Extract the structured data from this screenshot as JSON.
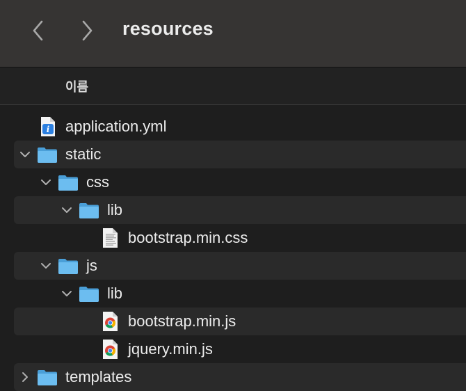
{
  "window": {
    "title": "resources",
    "nav": {
      "back_icon": "chevron-left-icon",
      "forward_icon": "chevron-right-icon"
    }
  },
  "list_header": {
    "name_column": "이름"
  },
  "items": [
    {
      "label": "application.yml",
      "kind": "file",
      "icon": "yaml-document-icon",
      "depth": 0,
      "disclosure": "none"
    },
    {
      "label": "static",
      "kind": "folder",
      "icon": "folder-icon",
      "depth": 0,
      "disclosure": "expanded"
    },
    {
      "label": "css",
      "kind": "folder",
      "icon": "folder-icon",
      "depth": 1,
      "disclosure": "expanded"
    },
    {
      "label": "lib",
      "kind": "folder",
      "icon": "folder-icon",
      "depth": 2,
      "disclosure": "expanded"
    },
    {
      "label": "bootstrap.min.css",
      "kind": "file",
      "icon": "css-document-icon",
      "depth": 3,
      "disclosure": "none"
    },
    {
      "label": "js",
      "kind": "folder",
      "icon": "folder-icon",
      "depth": 1,
      "disclosure": "expanded"
    },
    {
      "label": "lib",
      "kind": "folder",
      "icon": "folder-icon",
      "depth": 2,
      "disclosure": "expanded"
    },
    {
      "label": "bootstrap.min.js",
      "kind": "file",
      "icon": "chrome-document-icon",
      "depth": 3,
      "disclosure": "none"
    },
    {
      "label": "jquery.min.js",
      "kind": "file",
      "icon": "chrome-document-icon",
      "depth": 3,
      "disclosure": "none"
    },
    {
      "label": "templates",
      "kind": "folder",
      "icon": "folder-icon",
      "depth": 0,
      "disclosure": "collapsed"
    }
  ],
  "colors": {
    "toolbar": "#363433",
    "background": "#1e1e1e",
    "alt_row": "#2a2a2a",
    "folder": "#5fb4ea",
    "text": "#ececec"
  }
}
